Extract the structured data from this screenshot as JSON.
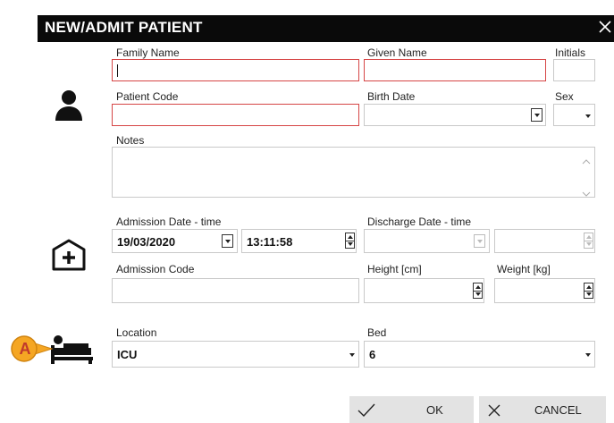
{
  "dialog": {
    "title": "NEW/ADMIT PATIENT"
  },
  "patient": {
    "family_name_label": "Family Name",
    "family_name_value": "",
    "given_name_label": "Given Name",
    "given_name_value": "",
    "initials_label": "Initials",
    "initials_value": "",
    "patient_code_label": "Patient Code",
    "patient_code_value": "",
    "birth_date_label": "Birth Date",
    "birth_date_value": "",
    "sex_label": "Sex",
    "sex_value": "",
    "notes_label": "Notes",
    "notes_value": ""
  },
  "admission": {
    "admission_label": "Admission Date - time",
    "admission_date": "19/03/2020",
    "admission_time": "13:11:58",
    "discharge_label": "Discharge Date - time",
    "discharge_date": "",
    "discharge_time": "",
    "admission_code_label": "Admission Code",
    "admission_code_value": "",
    "height_label": "Height [cm]",
    "height_value": "",
    "weight_label": "Weight [kg]",
    "weight_value": ""
  },
  "location": {
    "location_label": "Location",
    "location_value": "ICU",
    "bed_label": "Bed",
    "bed_value": "6"
  },
  "callout": {
    "letter": "A",
    "color": "#f5a623"
  },
  "footer": {
    "ok_label": "OK",
    "cancel_label": "CANCEL"
  },
  "icons": {
    "person": "person-icon",
    "hospital": "hospital-plus-icon",
    "bed": "bed-icon",
    "check": "check-icon",
    "x": "x-icon",
    "close": "close-icon"
  },
  "colors": {
    "titlebar": "#0a0a0a",
    "required_border": "#d64545",
    "button_bg": "#e3e3e3"
  }
}
